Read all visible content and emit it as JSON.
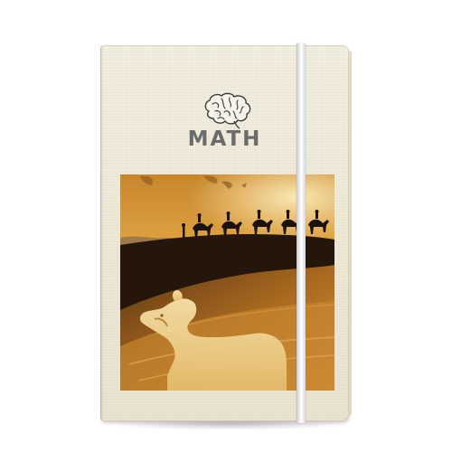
{
  "notebook": {
    "title": "MATH",
    "logo_icon": "brain-icon"
  },
  "colors": {
    "cover": "#efe9d8",
    "title_text": "#6b6b6b",
    "sky_top": "#d89a36",
    "sky_bottom": "#f2c05c",
    "dune_dark": "#1e140b",
    "sand": "#b9782a",
    "band": "#f1f1f1"
  }
}
